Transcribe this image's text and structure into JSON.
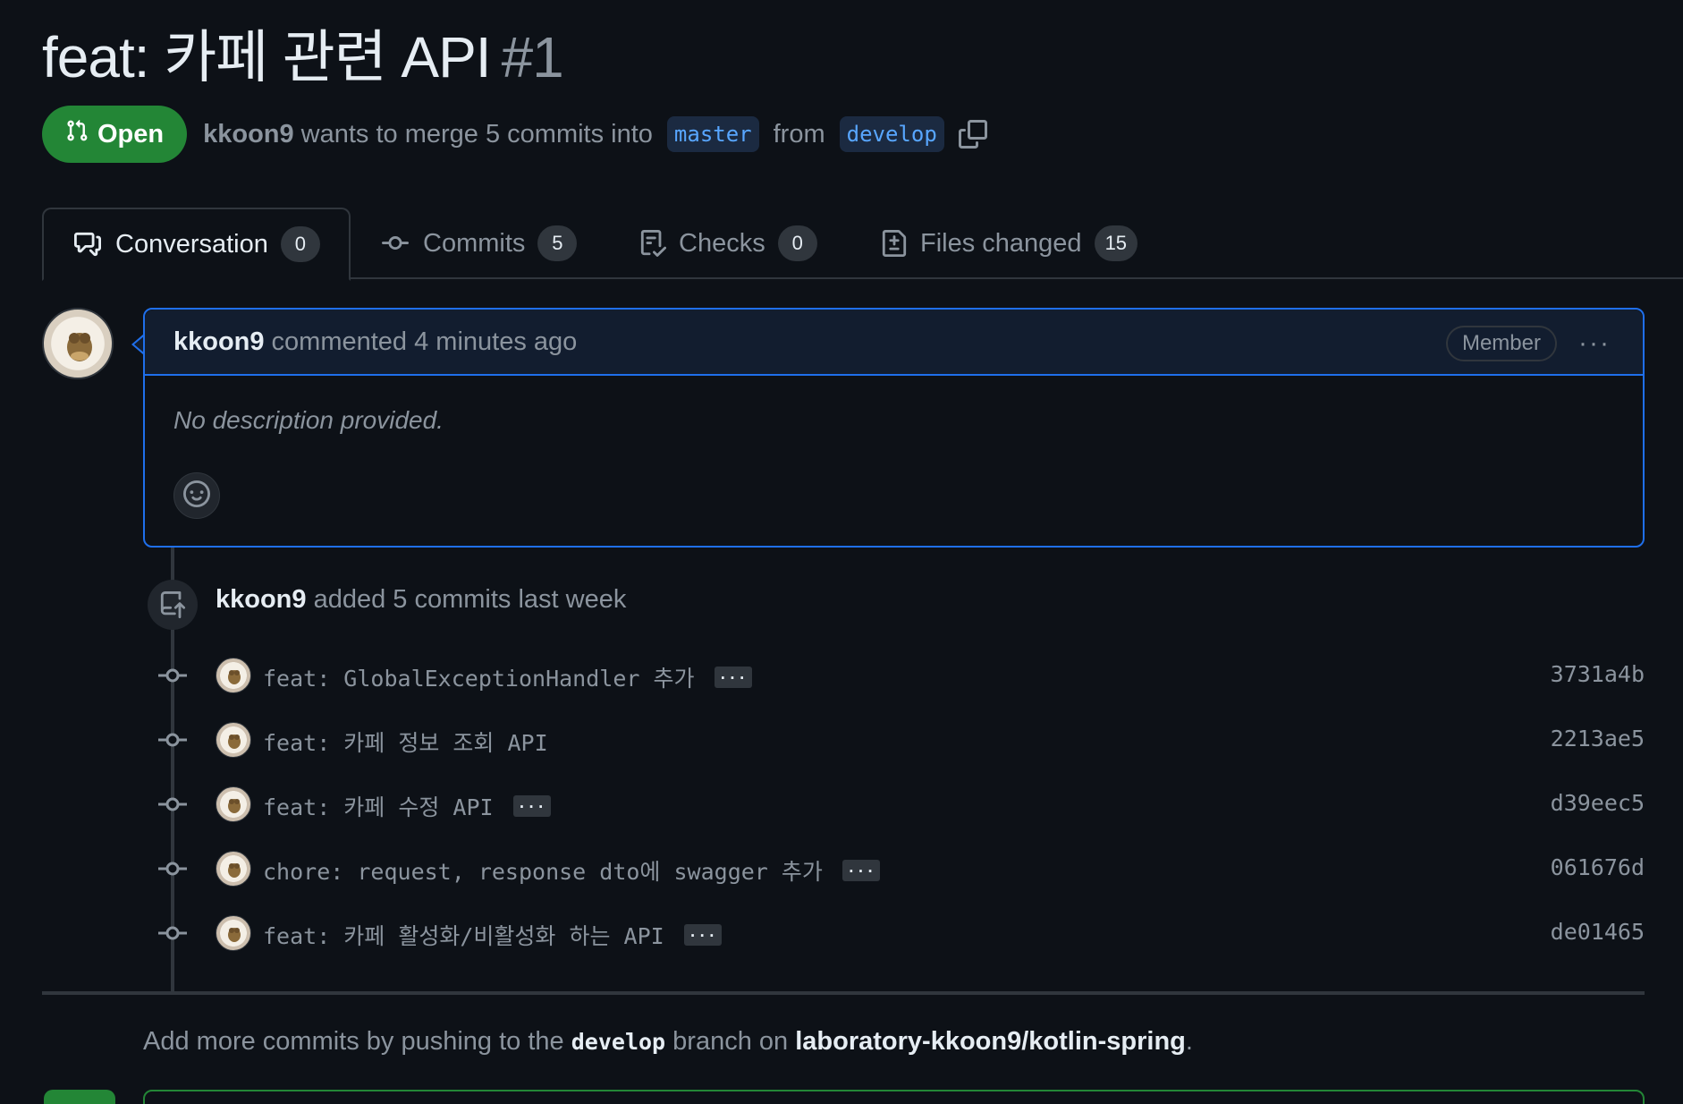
{
  "pr": {
    "title": "feat: 카페 관련 API",
    "number": "#1",
    "state": "Open",
    "author": "kkoon9",
    "summary_pre": "wants to merge 5 commits into",
    "base_branch": "master",
    "summary_mid": "from",
    "head_branch": "develop"
  },
  "tabs": [
    {
      "label": "Conversation",
      "count": "0",
      "icon": "comment-discussion-icon"
    },
    {
      "label": "Commits",
      "count": "5",
      "icon": "git-commit-icon"
    },
    {
      "label": "Checks",
      "count": "0",
      "icon": "checklist-icon"
    },
    {
      "label": "Files changed",
      "count": "15",
      "icon": "file-diff-icon"
    }
  ],
  "comment": {
    "author": "kkoon9",
    "meta": "commented 4 minutes ago",
    "role_badge": "Member",
    "more_label": "···",
    "body": "No description provided."
  },
  "push_event": {
    "author": "kkoon9",
    "text": "added 5 commits last week"
  },
  "commits": [
    {
      "message": "feat: GlobalExceptionHandler 추가",
      "has_more": true,
      "sha": "3731a4b"
    },
    {
      "message": "feat: 카페 정보 조회 API",
      "has_more": false,
      "sha": "2213ae5"
    },
    {
      "message": "feat: 카페 수정 API",
      "has_more": true,
      "sha": "d39eec5"
    },
    {
      "message": "chore: request, response dto에 swagger 추가",
      "has_more": true,
      "sha": "061676d"
    },
    {
      "message": "feat: 카페 활성화/비활성화 하는 API",
      "has_more": true,
      "sha": "de01465"
    }
  ],
  "commit_more_label": "···",
  "footer": {
    "pre": "Add more commits by pushing to the",
    "branch": "develop",
    "mid": "branch on",
    "repo": "laboratory-kkoon9/kotlin-spring",
    "post": "."
  },
  "colors": {
    "background": "#0d1117",
    "open_green": "#238636",
    "accent_blue": "#1f6feb",
    "link_blue": "#58a6ff",
    "muted": "#8b949e"
  }
}
